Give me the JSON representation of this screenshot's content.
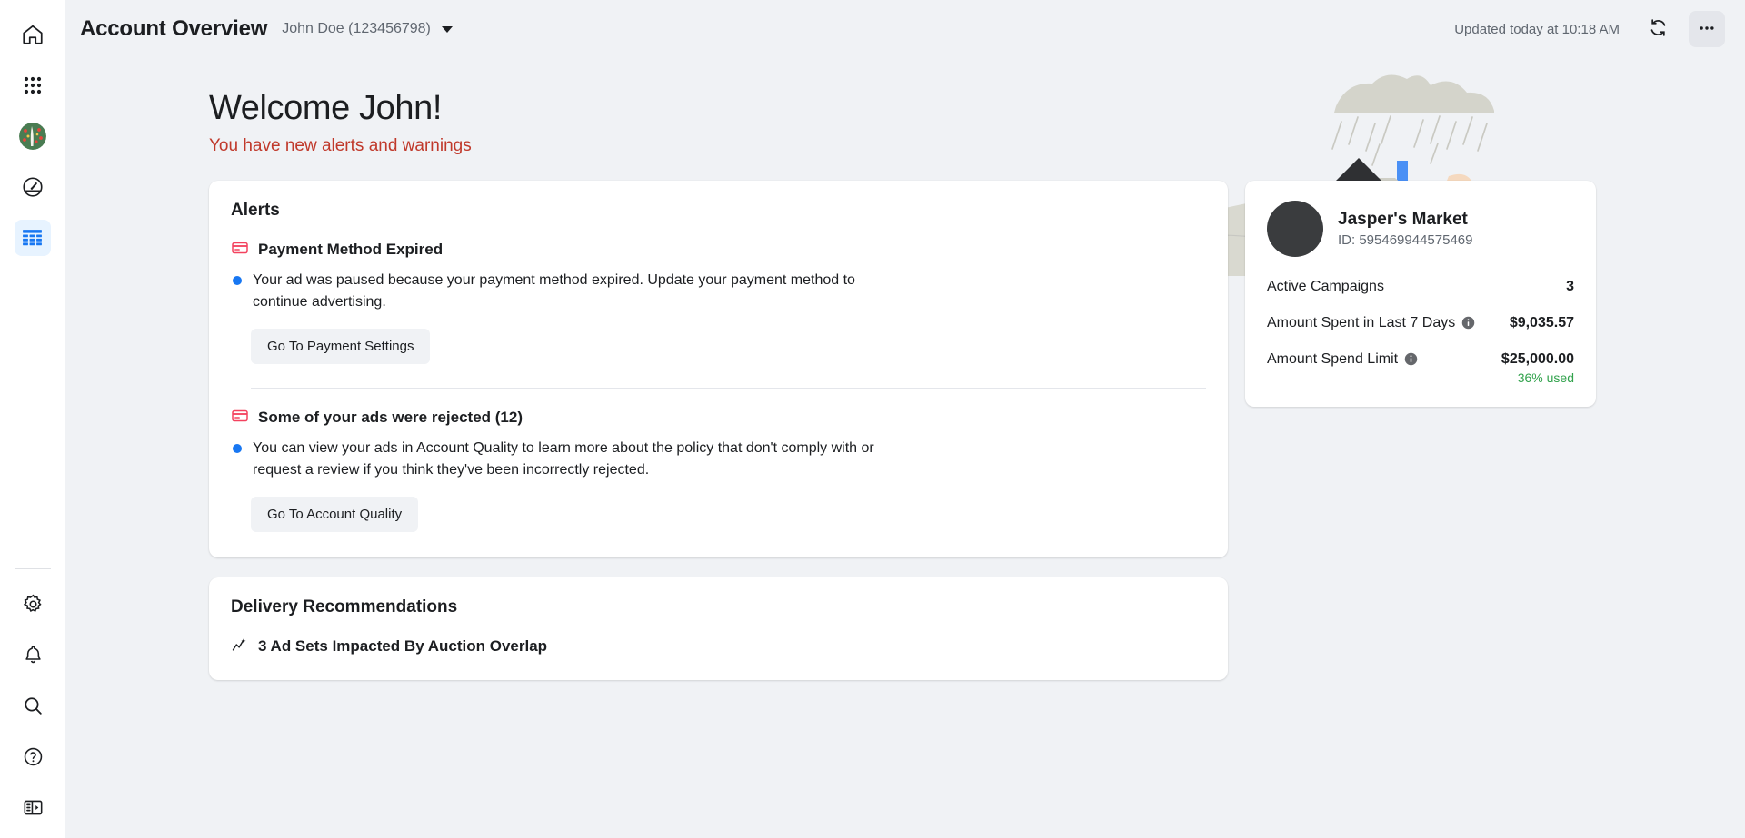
{
  "header": {
    "title": "Account Overview",
    "account_name": "John Doe (123456798)",
    "updated_text": "Updated today at 10:18 AM",
    "caret_icon": "chevron-down-icon",
    "refresh_icon": "refresh-icon",
    "more_icon": "more-horizontal-icon"
  },
  "sidebar": {
    "top_items": [
      {
        "name": "home",
        "icon": "home-icon",
        "active": false
      },
      {
        "name": "all-tools",
        "icon": "grid-apps-icon",
        "active": false
      },
      {
        "name": "business-avatar",
        "icon": "avatar-icon",
        "active": false
      },
      {
        "name": "performance",
        "icon": "gauge-icon",
        "active": false
      },
      {
        "name": "account-overview",
        "icon": "table-icon",
        "active": true
      }
    ],
    "bottom_items": [
      {
        "name": "settings",
        "icon": "gear-icon"
      },
      {
        "name": "notifications",
        "icon": "bell-icon"
      },
      {
        "name": "search",
        "icon": "search-icon"
      },
      {
        "name": "help",
        "icon": "question-circle-icon"
      },
      {
        "name": "collapse-panel",
        "icon": "panel-toggle-icon"
      }
    ]
  },
  "welcome": {
    "title": "Welcome John!",
    "subtitle": "You have new alerts and warnings",
    "subtitle_color": "#c0392b"
  },
  "alerts": {
    "card_title": "Alerts",
    "items": [
      {
        "icon": "credit-card-icon",
        "title": "Payment Method Expired",
        "body": "Your ad was paused because your payment method expired. Update your payment method to continue advertising.",
        "button": "Go To Payment Settings"
      },
      {
        "icon": "credit-card-icon",
        "title": "Some of your ads were rejected (12)",
        "body": "You can view your ads in Account Quality to learn more about the policy that don't comply with or request a review if you think they've been incorrectly rejected.",
        "button": "Go To Account Quality"
      }
    ]
  },
  "recommendations": {
    "card_title": "Delivery Recommendations",
    "items": [
      {
        "icon": "trending-line-icon",
        "text": "3 Ad Sets Impacted By Auction Overlap"
      }
    ]
  },
  "account_card": {
    "business_name": "Jasper's Market",
    "id_label": "ID: 595469944575469",
    "avatar_color": "#3a3c3e",
    "stats": [
      {
        "label": "Active Campaigns",
        "value": "3",
        "has_info": false,
        "sub": ""
      },
      {
        "label": "Amount Spent in Last 7 Days",
        "value": "$9,035.57",
        "has_info": true,
        "sub": ""
      },
      {
        "label": "Amount Spend Limit",
        "value": "$25,000.00",
        "has_info": true,
        "sub": "36% used"
      }
    ]
  },
  "colors": {
    "accent_blue": "#1877f2",
    "page_bg": "#f0f2f5",
    "card_bg": "#ffffff",
    "alert_red": "#c0392b",
    "success_green": "#31a24c",
    "card_icon_red": "#f3425f",
    "active_rail_bg": "#e7f3ff"
  }
}
